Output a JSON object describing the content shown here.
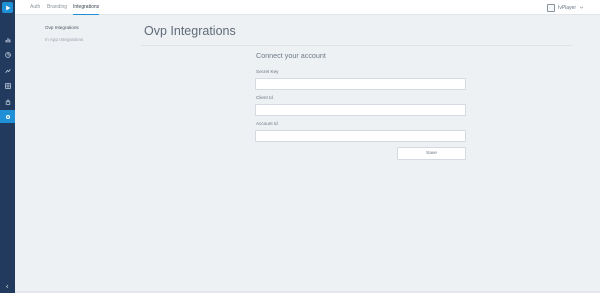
{
  "topbar": {
    "tabs": [
      {
        "label": "Auth",
        "active": false
      },
      {
        "label": "Branding",
        "active": false
      },
      {
        "label": "Integrations",
        "active": true
      }
    ],
    "account": {
      "name": "IvPlayer",
      "icon": "account-icon"
    }
  },
  "sidebar": {
    "logo_icon": "play-logo-icon",
    "items": [
      {
        "icon": "chart-icon"
      },
      {
        "icon": "pie-chart-icon"
      },
      {
        "icon": "analytics-icon"
      },
      {
        "icon": "grid-icon"
      },
      {
        "icon": "lock-icon"
      },
      {
        "icon": "gear-icon",
        "active": true
      }
    ],
    "collapse_icon": "chevron-left-icon"
  },
  "subnav": {
    "items": [
      {
        "label": "Ovp Integrations",
        "active": true
      },
      {
        "label": "In App Integrations",
        "active": false
      }
    ]
  },
  "main": {
    "title": "Ovp Integrations",
    "section_title": "Connect your account",
    "fields": [
      {
        "label": "Secret Key",
        "value": ""
      },
      {
        "label": "Client Id",
        "value": ""
      },
      {
        "label": "Account Id",
        "value": ""
      }
    ],
    "save_label": "Save"
  },
  "colors": {
    "sidebar_bg": "#223a5e",
    "accent": "#1f8fd6",
    "page_bg": "#eef1f4"
  }
}
